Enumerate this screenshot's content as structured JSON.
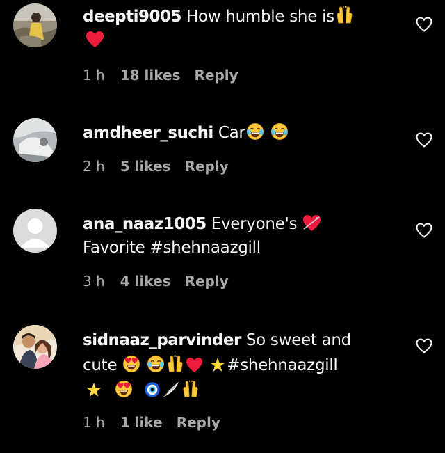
{
  "comments": [
    {
      "username": "deepti9005",
      "text": "How humble she is",
      "time": "1 h",
      "likes": "18 likes",
      "reply": "Reply"
    },
    {
      "username": "amdheer_suchi",
      "text": "Car",
      "time": "2 h",
      "likes": "5 likes",
      "reply": "Reply"
    },
    {
      "username": "ana_naaz1005",
      "text": "Everyone's",
      "text2": "Favorite #shehnaazgill",
      "time": "3 h",
      "likes": "4 likes",
      "reply": "Reply"
    },
    {
      "username": "sidnaaz_parvinder",
      "text": "So sweet and",
      "text2": "cute",
      "hashtag": "#shehnaazgill",
      "time": "1 h",
      "likes": "1 like",
      "reply": "Reply"
    }
  ],
  "icons": {
    "like": "heart-outline-icon",
    "emoji_raised_hands": "raised-hands-emoji",
    "emoji_red_heart": "red-heart-emoji",
    "emoji_tears_of_joy": "tears-of-joy-emoji",
    "emoji_heart_eyes": "heart-eyes-emoji",
    "emoji_star": "star-emoji",
    "emoji_nazar": "nazar-amulet-emoji",
    "emoji_cupid": "heart-with-arrow-emoji",
    "emoji_feather": "feather-emoji"
  },
  "colors": {
    "background": "#000000",
    "text": "#f5f5f5",
    "secondary": "#a8a8a8",
    "heart_red": "#ed1c3c",
    "emoji_yellow": "#ffc83d"
  }
}
